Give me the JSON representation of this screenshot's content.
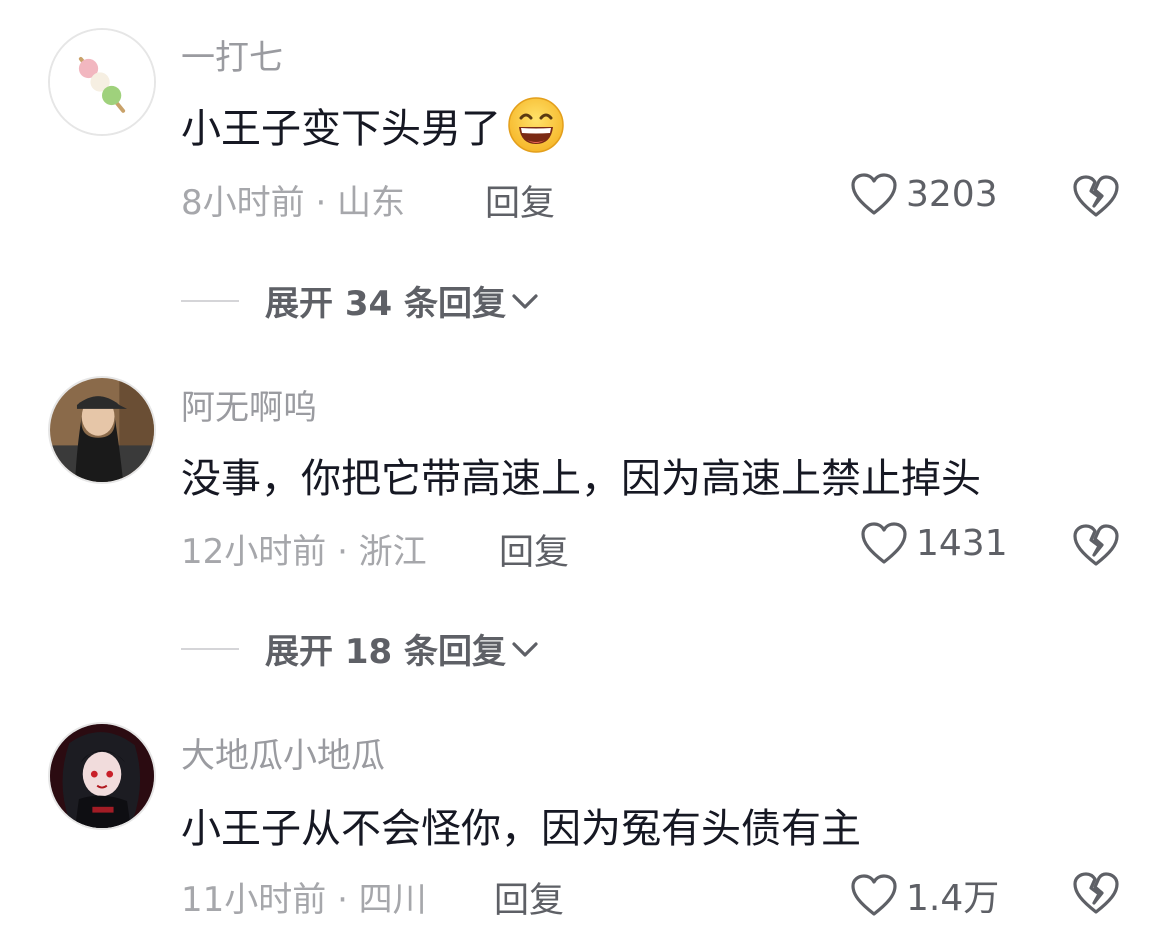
{
  "comments": [
    {
      "username": "一打七",
      "avatar_icon": "dango-avatar",
      "text": "小王子变下头男了",
      "emoji": "grin-emoji",
      "meta": "8小时前 · 山东",
      "reply_label": "回复",
      "like_count": "3203",
      "expand_label": "展开 34 条回复"
    },
    {
      "username": "阿无啊呜",
      "avatar_icon": "person-photo-avatar",
      "text": "没事，你把它带高速上，因为高速上禁止掉头",
      "meta": "12小时前 · 浙江",
      "reply_label": "回复",
      "like_count": "1431",
      "expand_label": "展开 18 条回复"
    },
    {
      "username": "大地瓜小地瓜",
      "avatar_icon": "anime-character-avatar",
      "text": "小王子从不会怪你，因为冤有头债有主",
      "meta": "11小时前 · 四川",
      "reply_label": "回复",
      "like_count": "1.4万"
    }
  ],
  "colors": {
    "username": "#9a9ba0",
    "text": "#161823",
    "meta": "#a6a7ab",
    "action": "#5e6066"
  }
}
